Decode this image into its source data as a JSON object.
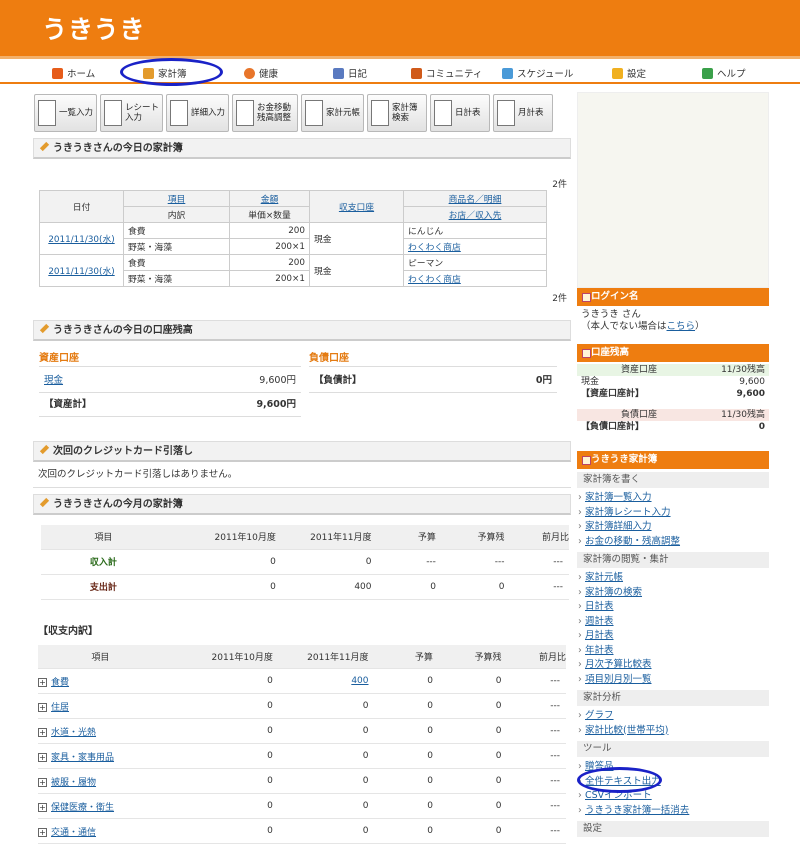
{
  "header": {
    "logo": "うきうき"
  },
  "nav": [
    {
      "label": "ホーム",
      "icon": "home-icon",
      "color": "#e65c1a"
    },
    {
      "label": "家計簿",
      "icon": "pencil-icon",
      "color": "#e39b2d"
    },
    {
      "label": "健康",
      "icon": "heart-icon",
      "color": "#e8752a"
    },
    {
      "label": "日記",
      "icon": "person-icon",
      "color": "#5a7ac0"
    },
    {
      "label": "コミュニティ",
      "icon": "people-icon",
      "color": "#d05a1a"
    },
    {
      "label": "スケジュール",
      "icon": "calendar-icon",
      "color": "#4a9ad8"
    },
    {
      "label": "設定",
      "icon": "star-icon",
      "color": "#f0b020"
    },
    {
      "label": "ヘルプ",
      "icon": "book-icon",
      "color": "#3aa04a"
    }
  ],
  "toolbar": [
    {
      "label": "一覧入力"
    },
    {
      "label": "レシート入力"
    },
    {
      "label": "詳細入力"
    },
    {
      "label": "お金移動 残高調整"
    },
    {
      "label": "家計元帳"
    },
    {
      "label": "家計簿 検索"
    },
    {
      "label": "日計表"
    },
    {
      "label": "月計表"
    }
  ],
  "today": {
    "title": "うきうきさんの今日の家計簿",
    "count": "2件",
    "head": {
      "date": "日付",
      "item": "項目",
      "detail": "内訳",
      "amount": "金額",
      "unit": "単価×数量",
      "account": "収支口座",
      "product": "商品名／明細",
      "shop": "お店／収入先"
    },
    "rows": [
      {
        "date": "2011/11/30(水)",
        "item": "食費",
        "sub": "野菜・海藻",
        "amount": "200",
        "unit": "200×1",
        "account": "現金",
        "product": "にんじん",
        "shop": "わくわく商店"
      },
      {
        "date": "2011/11/30(水)",
        "item": "食費",
        "sub": "野菜・海藻",
        "amount": "200",
        "unit": "200×1",
        "account": "現金",
        "product": "ピーマン",
        "shop": "わくわく商店"
      }
    ]
  },
  "balance": {
    "title": "うきうきさんの今日の口座残高",
    "assets_title": "資産口座",
    "cash_label": "現金",
    "cash_value": "9,600円",
    "assets_total_label": "【資産計】",
    "assets_total_value": "9,600円",
    "liab_title": "負債口座",
    "liab_total_label": "【負債計】",
    "liab_total_value": "0円"
  },
  "credit": {
    "title": "次回のクレジットカード引落し",
    "text": "次回のクレジットカード引落しはありません。"
  },
  "month": {
    "title": "うきうきさんの今月の家計簿",
    "headers": [
      "項目",
      "2011年10月度",
      "2011年11月度",
      "予算",
      "予算残",
      "前月比"
    ],
    "rows": [
      {
        "label": "収入計",
        "oct": "0",
        "nov": "0",
        "budget": "---",
        "remain": "---",
        "ratio": "---"
      },
      {
        "label": "支出計",
        "oct": "0",
        "nov": "400",
        "budget": "0",
        "remain": "0",
        "ratio": "---"
      }
    ]
  },
  "breakdown": {
    "title": "【収支内訳】",
    "rows": [
      {
        "label": "食費",
        "oct": "0",
        "nov": "400",
        "budget": "0",
        "remain": "0",
        "ratio": "---"
      },
      {
        "label": "住居",
        "oct": "0",
        "nov": "0",
        "budget": "0",
        "remain": "0",
        "ratio": "---"
      },
      {
        "label": "水道・光熱",
        "oct": "0",
        "nov": "0",
        "budget": "0",
        "remain": "0",
        "ratio": "---"
      },
      {
        "label": "家具・家事用品",
        "oct": "0",
        "nov": "0",
        "budget": "0",
        "remain": "0",
        "ratio": "---"
      },
      {
        "label": "被服・履物",
        "oct": "0",
        "nov": "0",
        "budget": "0",
        "remain": "0",
        "ratio": "---"
      },
      {
        "label": "保健医療・衛生",
        "oct": "0",
        "nov": "0",
        "budget": "0",
        "remain": "0",
        "ratio": "---"
      },
      {
        "label": "交通・通信",
        "oct": "0",
        "nov": "0",
        "budget": "0",
        "remain": "0",
        "ratio": "---"
      }
    ]
  },
  "sidebar": {
    "login_title": "ログイン名",
    "user": "うきうき さん",
    "not_you_pre": "（本人でない場合は",
    "not_you_link": "こちら",
    "not_you_post": "）",
    "acct_title": "口座残高",
    "assets_head": "資産口座",
    "assets_date": "11/30残高",
    "cash_label": "現金",
    "cash_value": "9,600",
    "assets_total_label": "【資産口座計】",
    "assets_total_value": "9,600",
    "liab_head": "負債口座",
    "liab_date": "11/30残高",
    "liab_total_label": "【負債口座計】",
    "liab_total_value": "0",
    "menu_title": "うきうき家計簿",
    "groups": [
      {
        "title": "家計簿を書く",
        "links": [
          "家計簿一覧入力",
          "家計簿レシート入力",
          "家計簿詳細入力",
          "お金の移動・残高調整"
        ]
      },
      {
        "title": "家計簿の閲覧・集計",
        "links": [
          "家計元帳",
          "家計簿の検索",
          "日計表",
          "週計表",
          "月計表",
          "年計表",
          "月次予算比較表",
          "項目別月別一覧"
        ]
      },
      {
        "title": "家計分析",
        "links": [
          "グラフ",
          "家計比較(世帯平均)"
        ]
      },
      {
        "title": "ツール",
        "links": [
          "贈答品",
          "全件テキスト出力",
          "CSVインポート",
          "うきうき家計簿一括消去"
        ]
      },
      {
        "title": "設定",
        "links": []
      }
    ]
  }
}
